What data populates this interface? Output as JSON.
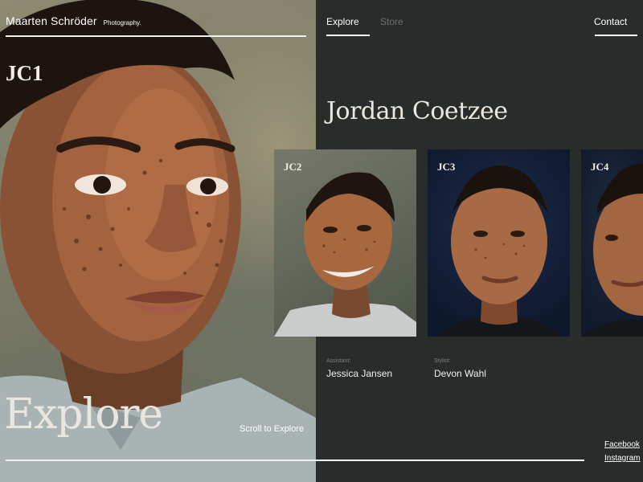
{
  "brand": {
    "name": "Maarten Schröder",
    "tagline": "Photography."
  },
  "nav": {
    "explore": "Explore",
    "store": "Store",
    "contact": "Contact"
  },
  "hero": {
    "code": "JC1",
    "title": "Explore",
    "scroll_label": "Scroll to Explore"
  },
  "person": {
    "name": "Jordan Coetzee"
  },
  "gallery": [
    {
      "code": "JC2"
    },
    {
      "code": "JC3"
    },
    {
      "code": "JC4"
    }
  ],
  "credits": {
    "assistant": {
      "label": "Assistant:",
      "value": "Jessica Jansen"
    },
    "stylist": {
      "label": "Stylist:",
      "value": "Devon Wahl"
    }
  },
  "social": {
    "facebook": "Facebook",
    "instagram": "Instagram"
  },
  "colors": {
    "panel": "#282d2c",
    "text": "#ffffff",
    "muted": "#6b706f"
  }
}
